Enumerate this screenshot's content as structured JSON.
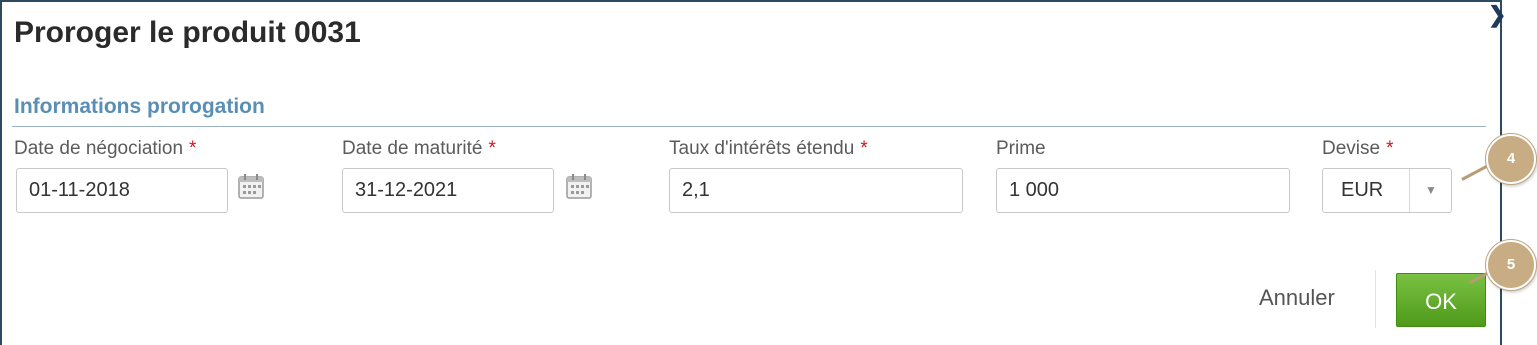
{
  "dialog": {
    "title": "Proroger le produit 0031",
    "section_title": "Informations prorogation"
  },
  "fields": {
    "date_negociation": {
      "label": "Date de négociation",
      "required_mark": "*",
      "value": "01-11-2018"
    },
    "date_maturite": {
      "label": "Date de maturité",
      "required_mark": "*",
      "value": "31-12-2021"
    },
    "taux": {
      "label": "Taux d'intérêts étendu",
      "required_mark": "*",
      "value": "2,1"
    },
    "prime": {
      "label": "Prime",
      "value": "1 000"
    },
    "devise": {
      "label": "Devise",
      "required_mark": "*",
      "value": "EUR"
    }
  },
  "actions": {
    "cancel_label": "Annuler",
    "ok_label": "OK"
  },
  "callouts": {
    "first": "4",
    "second": "5"
  },
  "icons": {
    "calendar": "calendar-icon",
    "dropdown": "chevron-down-icon",
    "close": "close-icon"
  },
  "colors": {
    "title": "#2b2b2b",
    "section": "#5a8fb5",
    "required": "#d0161f",
    "ok_button": "#5aa622",
    "callout": "#c8ad84",
    "border": "#2d4a63"
  }
}
